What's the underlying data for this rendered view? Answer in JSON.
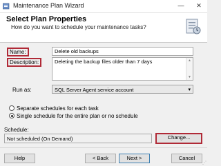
{
  "window": {
    "title": "Maintenance Plan Wizard",
    "minimize": "—",
    "close": "✕"
  },
  "header": {
    "title": "Select Plan Properties",
    "subtitle": "How do you want to schedule your maintenance tasks?"
  },
  "form": {
    "name_label": "Name:",
    "name_value": "Delete old backups",
    "description_label": "Description:",
    "description_value": "Deleting the backup files older than 7 days",
    "runas_label": "Run as:",
    "runas_value": "SQL Server Agent service account",
    "radio_separate": "Separate schedules for each task",
    "radio_single": "Single schedule for the entire plan or no schedule",
    "selected_option": "single",
    "schedule_label": "Schedule:",
    "schedule_value": "Not scheduled (On Demand)",
    "change_button": "Change..."
  },
  "footer": {
    "help": "Help",
    "back": "< Back",
    "next": "Next >",
    "cancel": "Cancel"
  },
  "icons": {
    "app": "wizard-app-icon",
    "header": "maintenance-plan-icon",
    "dropdown": "chevron-down-icon"
  },
  "colors": {
    "highlight": "#b02a37",
    "header_bg": "#ffffff",
    "dialog_bg": "#f0f0f0"
  }
}
